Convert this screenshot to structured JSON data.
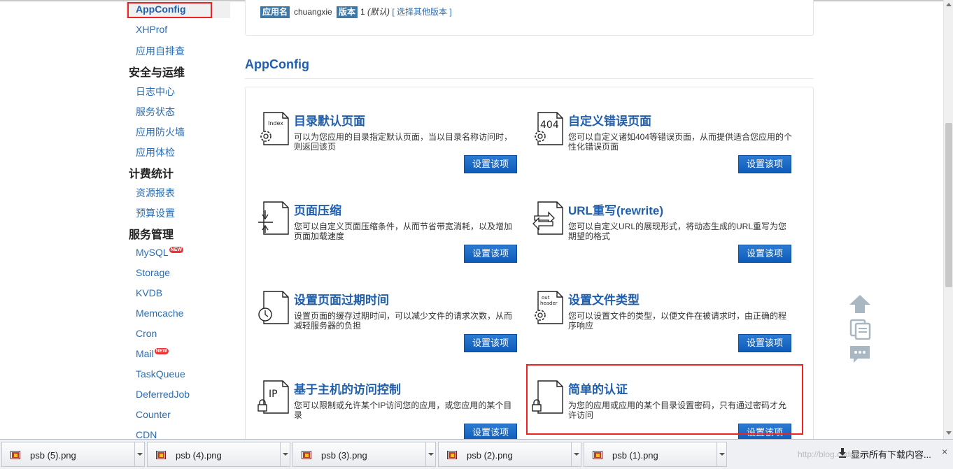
{
  "sidebar": {
    "active": "AppConfig",
    "links": [
      "XHProf",
      "应用自排查"
    ],
    "groups": [
      {
        "title": "安全与运维",
        "items": [
          "日志中心",
          "服务状态",
          "应用防火墙",
          "应用体检"
        ]
      },
      {
        "title": "计费统计",
        "items": [
          "资源报表",
          "预算设置"
        ]
      },
      {
        "title": "服务管理",
        "items": [
          "MySQL",
          "Storage",
          "KVDB",
          "Memcache",
          "Cron",
          "Mail",
          "TaskQueue",
          "DeferredJob",
          "Counter",
          "CDN"
        ]
      }
    ],
    "new_badge": "NEW"
  },
  "app_info": {
    "app_name_label": "应用名",
    "app_name": "chuangxie",
    "version_label": "版本",
    "version": "1",
    "version_default": "(默认)",
    "other_versions": "[ 选择其他版本 ]"
  },
  "section_title": "AppConfig",
  "features": [
    {
      "title": "目录默认页面",
      "desc": "可以为您应用的目录指定默认页面，当以目录名称访问时，则返回该页",
      "button": "设置该项",
      "icon": "index-gear-icon",
      "icon_text": "Index"
    },
    {
      "title": "自定义错误页面",
      "desc": "您可以自定义诸如404等错误页面，从而提供适合您应用的个性化错误页面",
      "button": "设置该项",
      "icon": "404-gear-icon",
      "icon_text": "404"
    },
    {
      "title": "页面压缩",
      "desc": "您可以自定义页面压缩条件，从而节省带宽消耗，以及增加页面加载速度",
      "button": "设置该项",
      "icon": "compress-icon",
      "icon_text": ""
    },
    {
      "title": "URL重写(rewrite)",
      "desc": "您可以自定义URL的展现形式，将动态生成的URL重写为您期望的格式",
      "button": "设置该项",
      "icon": "rewrite-arrows-icon",
      "icon_text": ""
    },
    {
      "title": "设置页面过期时间",
      "desc": "设置页面的缓存过期时间，可以减少文件的请求次数，从而减轻服务器的负担",
      "button": "设置该项",
      "icon": "clock-icon",
      "icon_text": ""
    },
    {
      "title": "设置文件类型",
      "desc": "您可以设置文件的类型，以便文件在被请求时，由正确的程序响应",
      "button": "设置该项",
      "icon": "header-gear-icon",
      "icon_text": "out header"
    },
    {
      "title": "基于主机的访问控制",
      "desc": "您可以限制或允许某个IP访问您的应用，或您应用的某个目录",
      "button": "设置该项",
      "icon": "ip-lock-icon",
      "icon_text": "IP"
    },
    {
      "title": "简单的认证",
      "desc": "为您的应用或应用的某个目录设置密码，只有通过密码才允许访问",
      "button": "设置该项",
      "icon": "lock-icon",
      "icon_text": ""
    }
  ],
  "downloads": {
    "files": [
      "psb (5).png",
      "psb (4).png",
      "psb (3).png",
      "psb (2).png",
      "psb (1).png"
    ],
    "show_all": "显示所有下载内容...",
    "watermark": "http://blog.csdn.net/",
    "close": "×"
  }
}
